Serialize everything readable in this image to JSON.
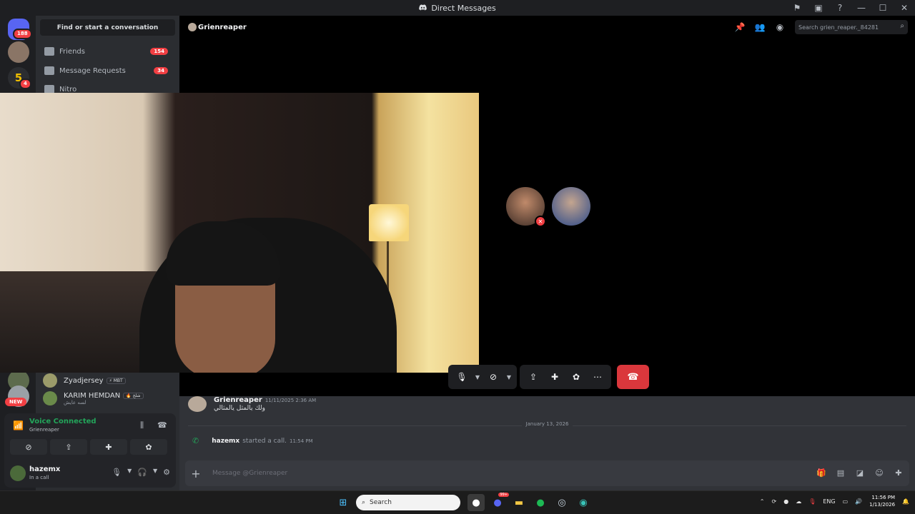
{
  "window": {
    "title": "Direct Messages"
  },
  "rail": {
    "notif_badge": "188",
    "badge2": "4"
  },
  "dm": {
    "find_label": "Find or start a conversation",
    "nav": [
      {
        "label": "Friends",
        "count": "154"
      },
      {
        "label": "Message Requests",
        "count": "34"
      },
      {
        "label": "Nitro",
        "count": ""
      }
    ]
  },
  "header": {
    "username": "Grienreaper",
    "search_placeholder": "Search grien_reaper._84281"
  },
  "chat": {
    "msg1": {
      "author": "Grienreaper",
      "time": "11/11/2025 2:36 AM",
      "text": "ولك يالمثل يالمثالي"
    },
    "date_divider": "January 13, 2026",
    "sys": {
      "user": "hazemx",
      "text": "started a call.",
      "time": "11:54 PM"
    },
    "composer_placeholder": "Message @Grienreaper"
  },
  "voice_users": [
    {
      "name": "Zyadjersey",
      "tag": "⚡ MBT"
    },
    {
      "name": "KARIM HEMDAN",
      "tag": "🔥 شلخ",
      "sub": "لسه عايش"
    }
  ],
  "rail_new_label": "NEW",
  "voice_panel": {
    "title": "Voice Connected",
    "channel": "Grienreaper"
  },
  "user": {
    "name": "hazemx",
    "status": "In a call"
  },
  "taskbar": {
    "search": "Search",
    "lang": "ENG",
    "time": "11:56 PM",
    "date": "1/13/2026",
    "discord_badge": "99+"
  },
  "colors": {
    "accent_green": "#23a55a",
    "danger_red": "#da373c",
    "bg_dark": "#313338"
  }
}
